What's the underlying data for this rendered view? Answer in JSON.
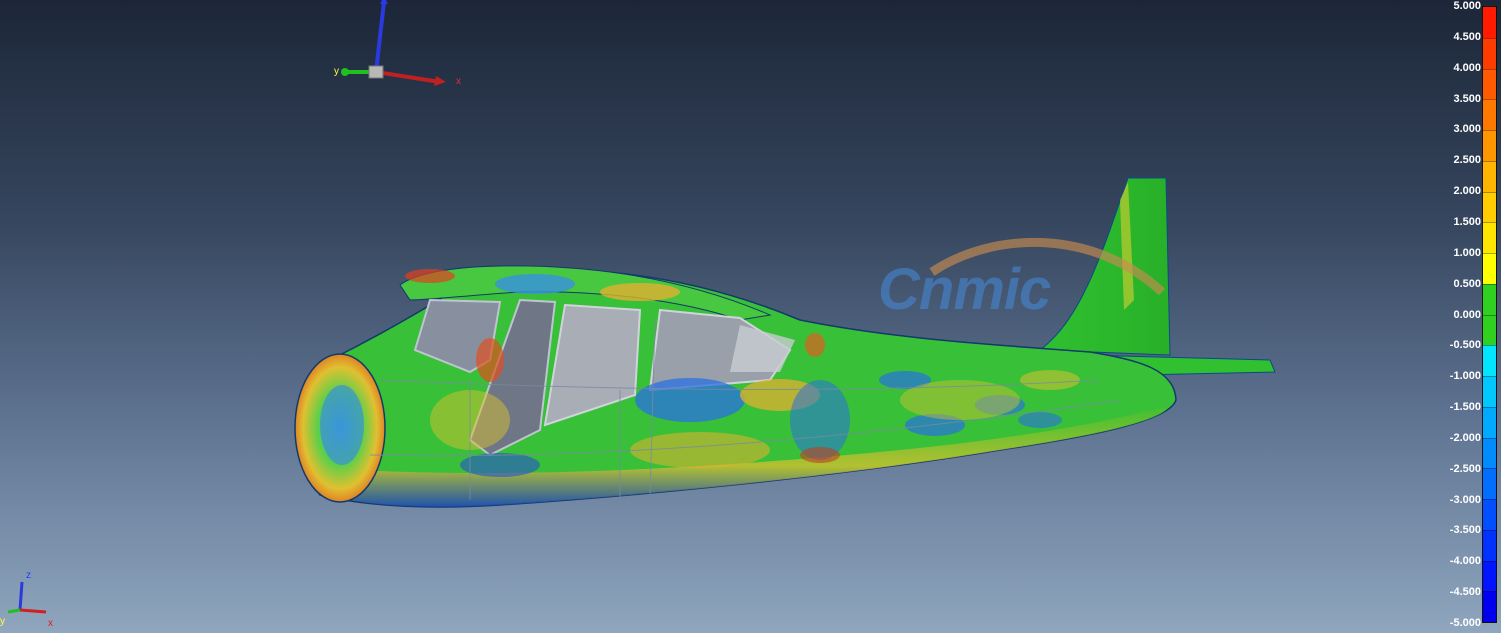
{
  "viewer": {
    "top_triad": {
      "x_label": "x",
      "y_label": "y"
    },
    "corner_triad": {
      "x_label": "x",
      "y_label": "y",
      "z_label": "z"
    },
    "watermark": {
      "text": "Cnmic"
    },
    "colors": {
      "background_top": "#1c2638",
      "background_bottom": "#8fa6be",
      "axis_x": "#e02020",
      "axis_y": "#20c020",
      "axis_z": "#2030e0"
    }
  },
  "legend": {
    "labels": [
      "5.000",
      "4.500",
      "4.000",
      "3.500",
      "3.000",
      "2.500",
      "2.000",
      "1.500",
      "1.000",
      "0.500",
      "0.000",
      "-0.500",
      "-1.000",
      "-1.500",
      "-2.000",
      "-2.500",
      "-3.000",
      "-3.500",
      "-4.000",
      "-4.500",
      "-5.000"
    ],
    "bands": [
      "#ff1a00",
      "#ff3c00",
      "#ff5a00",
      "#ff7800",
      "#ff9600",
      "#ffb400",
      "#ffcc00",
      "#ffe600",
      "#ffff00",
      "#30d020",
      "#30d020",
      "#00e6ff",
      "#00c8ff",
      "#00aaff",
      "#008cff",
      "#006eff",
      "#0050ff",
      "#0032ff",
      "#0014ff",
      "#0000ee"
    ]
  }
}
